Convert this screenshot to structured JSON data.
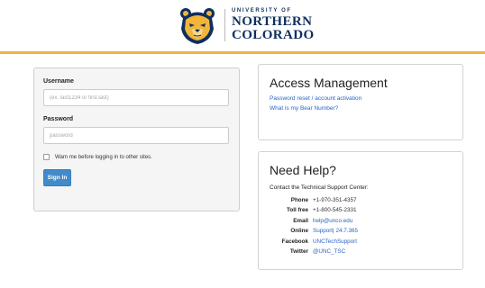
{
  "header": {
    "logo_top_line": "UNIVERSITY OF",
    "logo_line_1": "NORTHERN",
    "logo_line_2": "COLORADO",
    "colors": {
      "accent_bar": "#f2b53a",
      "brand_navy": "#0f2f5f",
      "brand_gold": "#f2b53a"
    }
  },
  "login": {
    "username_label": "Username",
    "username_placeholder": "(ex. last1234 or first.last)",
    "username_value": "",
    "password_label": "Password",
    "password_placeholder": "password",
    "password_value": "",
    "warn_label": "Warn me before logging in to other sites.",
    "warn_checked": false,
    "signin_label": "Sign In"
  },
  "access": {
    "title": "Access Management",
    "links": [
      {
        "label": "Password reset / account activation"
      },
      {
        "label": "What is my Bear Number?"
      }
    ]
  },
  "help": {
    "title": "Need Help?",
    "intro": "Contact the Technical Support Center:",
    "contacts": [
      {
        "key": "Phone",
        "value": "+1-970-351-4357",
        "is_link": false
      },
      {
        "key": "Toll free",
        "value": "+1-800-545-2331",
        "is_link": false
      },
      {
        "key": "Email",
        "value": "help@unco.edu",
        "is_link": true
      },
      {
        "key": "Online",
        "value": "Support| 24.7.365",
        "is_link": true
      },
      {
        "key": "Facebook",
        "value": "UNCTechSupport",
        "is_link": true
      },
      {
        "key": "Twitter",
        "value": "@UNC_TSC",
        "is_link": true
      }
    ]
  }
}
